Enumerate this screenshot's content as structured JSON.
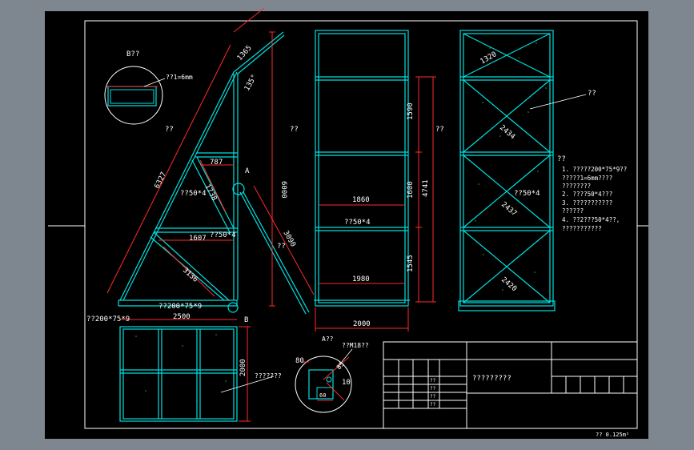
{
  "colors": {
    "background": "#7e8790",
    "sheet": "#000000",
    "frame": "#ffffff",
    "outline": "#00e0e0",
    "dimension": "#ff2a2a",
    "label": "#ffffff",
    "dots": "#1fae2a"
  },
  "views": {
    "detail_b_label": "B??",
    "detail_b_note": "??1=6mm",
    "side_view_label": "??",
    "front_view_label": "??",
    "back_view_label": "??",
    "detail_a_label": "A??",
    "detail_a_note": "??M18??",
    "point_a": "A",
    "point_b": "B"
  },
  "side_view": {
    "dim_top": "1365",
    "angle": "135°",
    "dim_height": "6000",
    "dim_diagonal": "6327",
    "dim_787": "787",
    "dim_1738": "1738",
    "dim_1607": "1607",
    "dim_3136": "3136",
    "dim_3090": "3090",
    "steel_note_1": "??50*4",
    "steel_note_2": "??50*4",
    "prop_note": "??",
    "base_note": "??200*75*9",
    "left_base_note": "??200*75*9",
    "dim_base": "2500"
  },
  "front_view": {
    "dim_1590": "1590",
    "dim_1600": "1600",
    "dim_4741": "4741",
    "dim_1545": "1545",
    "dim_width_upper": "1860",
    "dim_width_lower": "1980",
    "steel_note": "??50*4",
    "dim_total_width": "2000"
  },
  "back_view": {
    "dim_1320": "1320",
    "dim_2434": "2434",
    "dim_2437": "2437",
    "dim_2420": "2420",
    "steel_note": "??50*4",
    "leader_label": "??"
  },
  "plan_view": {
    "dim_depth": "2000",
    "note": "???????"
  },
  "detail_a": {
    "dim_80": "80",
    "dim_85": "85",
    "dim_10": "10",
    "dim_60": "60"
  },
  "notes": {
    "heading": "??",
    "lines": [
      "1. ?????200*75*9??",
      "   ?????1=6mm????",
      "   ????????",
      "2. ????50*4???",
      "3. ???????????",
      "   ??????",
      "4. ??2???50*4??,",
      "   ???????????"
    ]
  },
  "title_block": {
    "drawing_title": "?????????",
    "row_tags": [
      "??",
      "??",
      "??",
      "??"
    ],
    "footer_note": "??  0.125m²"
  }
}
